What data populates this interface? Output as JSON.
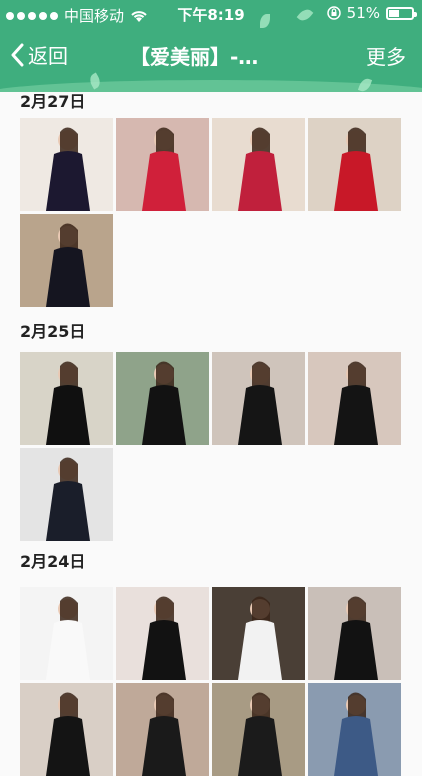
{
  "status_bar": {
    "carrier": "中国移动",
    "time": "下午8:19",
    "battery": "51%",
    "battery_level": 0.51
  },
  "nav": {
    "back_label": "返回",
    "title": "【爱美丽】-…",
    "more_label": "更多"
  },
  "sections": [
    {
      "date": "2月27日",
      "photos": [
        {
          "bg": "#efe9e3",
          "fg": "#1c1830"
        },
        {
          "bg": "#d6b8b0",
          "fg": "#d0203a"
        },
        {
          "bg": "#e8dcd0",
          "fg": "#c0203c"
        },
        {
          "bg": "#ddd2c5",
          "fg": "#c81828"
        },
        {
          "bg": "#b9a48c",
          "fg": "#151520"
        }
      ]
    },
    {
      "date": "2月25日",
      "photos": [
        {
          "bg": "#d8d4c8",
          "fg": "#101010"
        },
        {
          "bg": "#8fa38a",
          "fg": "#121212"
        },
        {
          "bg": "#cfc4bb",
          "fg": "#151515"
        },
        {
          "bg": "#d7c7bd",
          "fg": "#141414"
        },
        {
          "bg": "#e4e4e4",
          "fg": "#1a1e2a"
        }
      ]
    },
    {
      "date": "2月24日",
      "photos": [
        {
          "bg": "#f4f4f4",
          "fg": "#f9f9f9"
        },
        {
          "bg": "#e9e0dc",
          "fg": "#121212"
        },
        {
          "bg": "#4a3f36",
          "fg": "#f2f2f2"
        },
        {
          "bg": "#c9bfb8",
          "fg": "#121212"
        },
        {
          "bg": "#d9cfc6",
          "fg": "#141414"
        },
        {
          "bg": "#bfa999",
          "fg": "#1a1a1a"
        },
        {
          "bg": "#a89b84",
          "fg": "#1b1b1b"
        },
        {
          "bg": "#8a9bb0",
          "fg": "#3d5a86"
        }
      ]
    }
  ]
}
